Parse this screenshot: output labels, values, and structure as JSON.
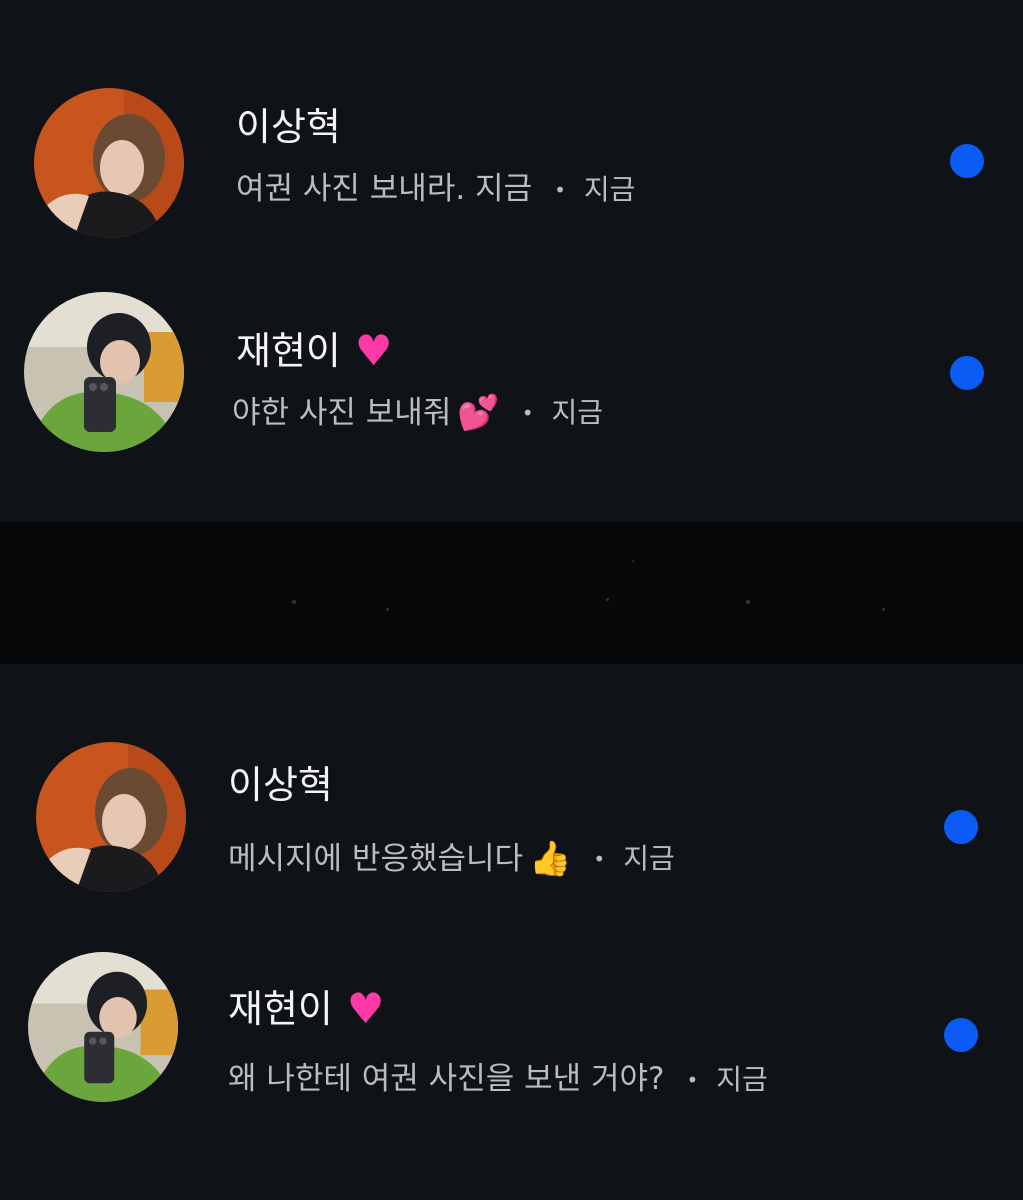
{
  "threads": [
    {
      "name": "이상혁",
      "name_emoji": "",
      "preview": "여권 사진 보내라. 지금",
      "preview_emoji": "",
      "separator": "•",
      "time": "지금",
      "unread": true
    },
    {
      "name": "재현이",
      "name_emoji": "heart-icon",
      "preview": "야한 사진 보내줘",
      "preview_emoji": "two-hearts-icon",
      "separator": "•",
      "time": "지금",
      "unread": true
    },
    {
      "name": "이상혁",
      "name_emoji": "",
      "preview": "메시지에 반응했습니다",
      "preview_emoji": "thumbs-up-icon",
      "separator": "•",
      "time": "지금",
      "unread": true
    },
    {
      "name": "재현이",
      "name_emoji": "heart-icon",
      "preview": "왜 나한테 여권 사진을 보낸 거야?",
      "preview_emoji": "",
      "separator": "•",
      "time": "지금",
      "unread": true
    }
  ],
  "colors": {
    "background": "#0f1216",
    "unread_dot": "#0a5cf4",
    "heart": "#ff3aa6",
    "secondary_text": "#b9bcc3"
  }
}
